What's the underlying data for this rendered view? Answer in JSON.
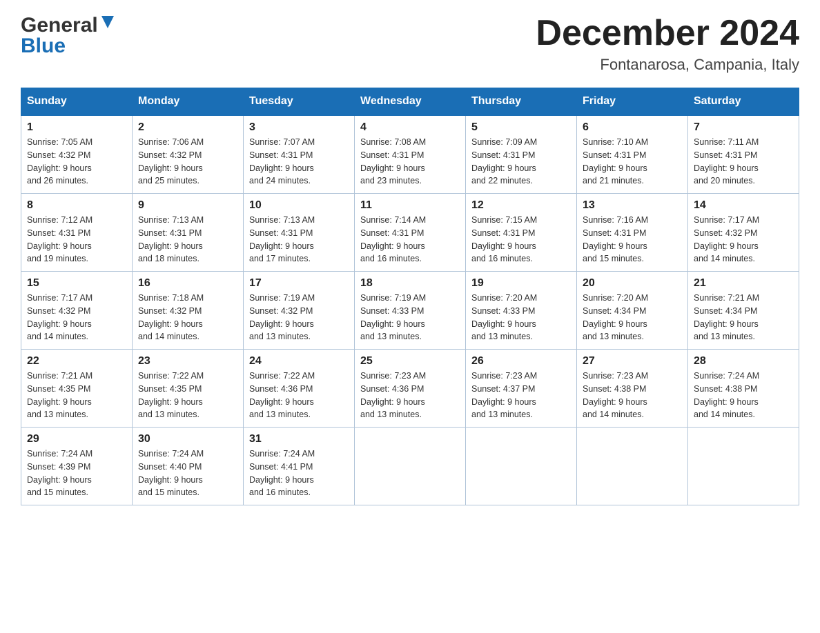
{
  "header": {
    "logo_general": "General",
    "logo_blue": "Blue",
    "title": "December 2024",
    "subtitle": "Fontanarosa, Campania, Italy"
  },
  "days_of_week": [
    "Sunday",
    "Monday",
    "Tuesday",
    "Wednesday",
    "Thursday",
    "Friday",
    "Saturday"
  ],
  "weeks": [
    [
      {
        "day": "1",
        "sunrise": "7:05 AM",
        "sunset": "4:32 PM",
        "daylight": "9 hours and 26 minutes."
      },
      {
        "day": "2",
        "sunrise": "7:06 AM",
        "sunset": "4:32 PM",
        "daylight": "9 hours and 25 minutes."
      },
      {
        "day": "3",
        "sunrise": "7:07 AM",
        "sunset": "4:31 PM",
        "daylight": "9 hours and 24 minutes."
      },
      {
        "day": "4",
        "sunrise": "7:08 AM",
        "sunset": "4:31 PM",
        "daylight": "9 hours and 23 minutes."
      },
      {
        "day": "5",
        "sunrise": "7:09 AM",
        "sunset": "4:31 PM",
        "daylight": "9 hours and 22 minutes."
      },
      {
        "day": "6",
        "sunrise": "7:10 AM",
        "sunset": "4:31 PM",
        "daylight": "9 hours and 21 minutes."
      },
      {
        "day": "7",
        "sunrise": "7:11 AM",
        "sunset": "4:31 PM",
        "daylight": "9 hours and 20 minutes."
      }
    ],
    [
      {
        "day": "8",
        "sunrise": "7:12 AM",
        "sunset": "4:31 PM",
        "daylight": "9 hours and 19 minutes."
      },
      {
        "day": "9",
        "sunrise": "7:13 AM",
        "sunset": "4:31 PM",
        "daylight": "9 hours and 18 minutes."
      },
      {
        "day": "10",
        "sunrise": "7:13 AM",
        "sunset": "4:31 PM",
        "daylight": "9 hours and 17 minutes."
      },
      {
        "day": "11",
        "sunrise": "7:14 AM",
        "sunset": "4:31 PM",
        "daylight": "9 hours and 16 minutes."
      },
      {
        "day": "12",
        "sunrise": "7:15 AM",
        "sunset": "4:31 PM",
        "daylight": "9 hours and 16 minutes."
      },
      {
        "day": "13",
        "sunrise": "7:16 AM",
        "sunset": "4:31 PM",
        "daylight": "9 hours and 15 minutes."
      },
      {
        "day": "14",
        "sunrise": "7:17 AM",
        "sunset": "4:32 PM",
        "daylight": "9 hours and 14 minutes."
      }
    ],
    [
      {
        "day": "15",
        "sunrise": "7:17 AM",
        "sunset": "4:32 PM",
        "daylight": "9 hours and 14 minutes."
      },
      {
        "day": "16",
        "sunrise": "7:18 AM",
        "sunset": "4:32 PM",
        "daylight": "9 hours and 14 minutes."
      },
      {
        "day": "17",
        "sunrise": "7:19 AM",
        "sunset": "4:32 PM",
        "daylight": "9 hours and 13 minutes."
      },
      {
        "day": "18",
        "sunrise": "7:19 AM",
        "sunset": "4:33 PM",
        "daylight": "9 hours and 13 minutes."
      },
      {
        "day": "19",
        "sunrise": "7:20 AM",
        "sunset": "4:33 PM",
        "daylight": "9 hours and 13 minutes."
      },
      {
        "day": "20",
        "sunrise": "7:20 AM",
        "sunset": "4:34 PM",
        "daylight": "9 hours and 13 minutes."
      },
      {
        "day": "21",
        "sunrise": "7:21 AM",
        "sunset": "4:34 PM",
        "daylight": "9 hours and 13 minutes."
      }
    ],
    [
      {
        "day": "22",
        "sunrise": "7:21 AM",
        "sunset": "4:35 PM",
        "daylight": "9 hours and 13 minutes."
      },
      {
        "day": "23",
        "sunrise": "7:22 AM",
        "sunset": "4:35 PM",
        "daylight": "9 hours and 13 minutes."
      },
      {
        "day": "24",
        "sunrise": "7:22 AM",
        "sunset": "4:36 PM",
        "daylight": "9 hours and 13 minutes."
      },
      {
        "day": "25",
        "sunrise": "7:23 AM",
        "sunset": "4:36 PM",
        "daylight": "9 hours and 13 minutes."
      },
      {
        "day": "26",
        "sunrise": "7:23 AM",
        "sunset": "4:37 PM",
        "daylight": "9 hours and 13 minutes."
      },
      {
        "day": "27",
        "sunrise": "7:23 AM",
        "sunset": "4:38 PM",
        "daylight": "9 hours and 14 minutes."
      },
      {
        "day": "28",
        "sunrise": "7:24 AM",
        "sunset": "4:38 PM",
        "daylight": "9 hours and 14 minutes."
      }
    ],
    [
      {
        "day": "29",
        "sunrise": "7:24 AM",
        "sunset": "4:39 PM",
        "daylight": "9 hours and 15 minutes."
      },
      {
        "day": "30",
        "sunrise": "7:24 AM",
        "sunset": "4:40 PM",
        "daylight": "9 hours and 15 minutes."
      },
      {
        "day": "31",
        "sunrise": "7:24 AM",
        "sunset": "4:41 PM",
        "daylight": "9 hours and 16 minutes."
      },
      null,
      null,
      null,
      null
    ]
  ],
  "labels": {
    "sunrise": "Sunrise:",
    "sunset": "Sunset:",
    "daylight": "Daylight:"
  }
}
